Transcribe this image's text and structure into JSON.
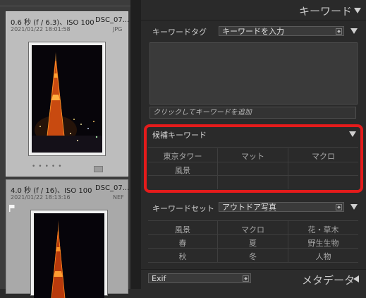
{
  "filmstrip": {
    "photos": [
      {
        "exposure": "0.6 秒 (f / 6.3)、ISO 100",
        "filename": "DSC_07...",
        "datetime": "2021/01/22 18:01:58",
        "filetype": "JPG"
      },
      {
        "exposure": "4.0 秒 (f / 16)、ISO 100",
        "filename": "DSC_07...",
        "datetime": "2021/01/22 18:13:16",
        "filetype": "NEF"
      }
    ]
  },
  "keywording": {
    "header_title": "キーワード",
    "keyword_tags_label": "キーワードタグ",
    "keyword_tags_select": "キーワードを入力",
    "add_placeholder": "クリックしてキーワードを追加",
    "suggestions_label": "候補キーワード",
    "suggestions": [
      "東京タワー",
      "マット",
      "マクロ",
      "風景",
      "",
      "",
      "",
      "",
      ""
    ],
    "keyword_set_label": "キーワードセット",
    "keyword_set_select": "アウトドア写真",
    "keyword_set": [
      "風景",
      "マクロ",
      "花・草木",
      "春",
      "夏",
      "野生生物",
      "秋",
      "冬",
      "人物"
    ]
  },
  "metadata_bar": {
    "preset_select": "Exif",
    "title": "メタデータ"
  },
  "colors": {
    "highlight": "#e41b1b",
    "panel_bg": "#2a2a2a",
    "filmstrip_selected": "#bdbdbd"
  },
  "icons": [
    "flag-icon",
    "thumbnail-toggle-icon",
    "collapse-triangle-icon",
    "select-arrow-icon",
    "expand-triangle-icon"
  ]
}
